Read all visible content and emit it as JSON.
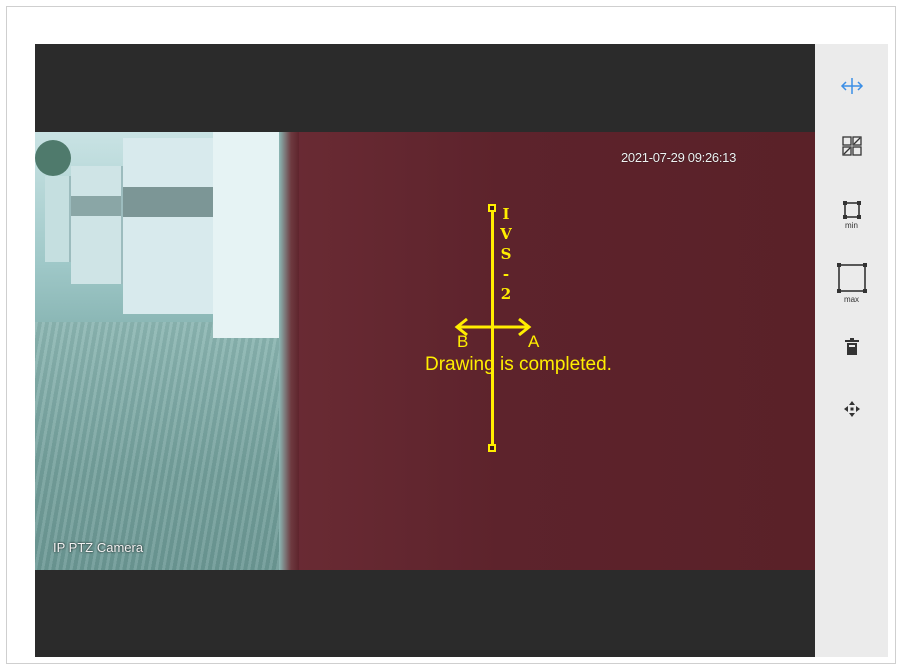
{
  "video": {
    "timestamp": "2021-07-29 09:26:13",
    "channel_name": "IP PTZ Camera",
    "rule_name": "IVS-2",
    "direction_a": "A",
    "direction_b": "B",
    "status_message": "Drawing is completed."
  },
  "toolbar": {
    "tools": [
      {
        "icon": "horizontal-arrows-icon",
        "name": "line-direction-tool"
      },
      {
        "icon": "target-filter-icon",
        "name": "target-filter-tool"
      },
      {
        "icon": "min-size-icon",
        "name": "min-size-tool",
        "label": "min"
      },
      {
        "icon": "max-size-icon",
        "name": "max-size-tool",
        "label": "max"
      },
      {
        "icon": "trash-icon",
        "name": "delete-tool"
      },
      {
        "icon": "move-icon",
        "name": "move-tool"
      }
    ]
  },
  "colors": {
    "rule_line": "#ffee00",
    "active_tool": "#3a8ee6",
    "tool_icon": "#333333",
    "toolbar_bg": "#ebebeb",
    "video_letterbox": "#2b2b2b"
  }
}
